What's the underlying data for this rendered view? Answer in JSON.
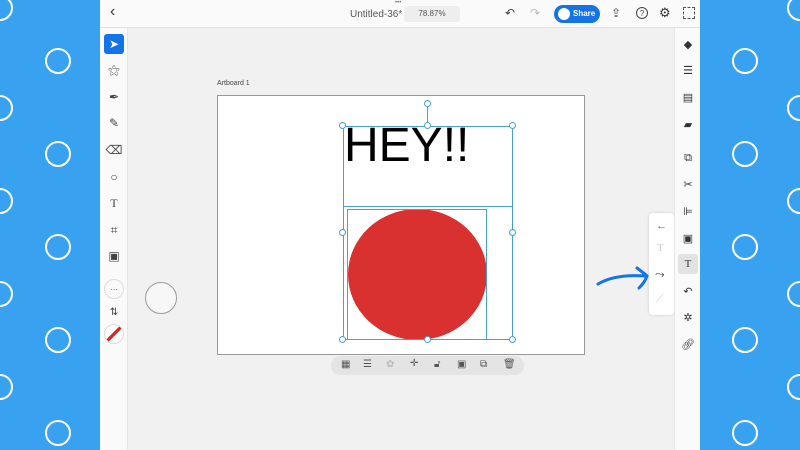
{
  "header": {
    "back": "‹",
    "more": "•••",
    "doc_title": "Untitled-36*",
    "zoom": "78.87%",
    "share_label": "Share"
  },
  "artboard": {
    "label": "Artboard 1",
    "text": "HEY!!"
  },
  "colors": {
    "accent": "#1473e6",
    "fill": "#d93030",
    "selection": "#4a9fd0",
    "background": "#38a2f0"
  },
  "tools": [
    "select",
    "direct-select",
    "pen",
    "pencil",
    "eraser",
    "ellipse",
    "type",
    "crop",
    "image",
    "more",
    "swap",
    "fill-stroke"
  ],
  "right_panel": [
    "layers",
    "properties",
    "libraries",
    "comments",
    "pathfinder",
    "scissors",
    "align",
    "transform",
    "type",
    "curve",
    "settings",
    "link"
  ],
  "flyout": [
    "back",
    "type-path",
    "warp",
    "line"
  ],
  "context_bar": [
    "grid",
    "menu",
    "repeat",
    "move",
    "lock",
    "mask",
    "duplicate",
    "delete"
  ]
}
